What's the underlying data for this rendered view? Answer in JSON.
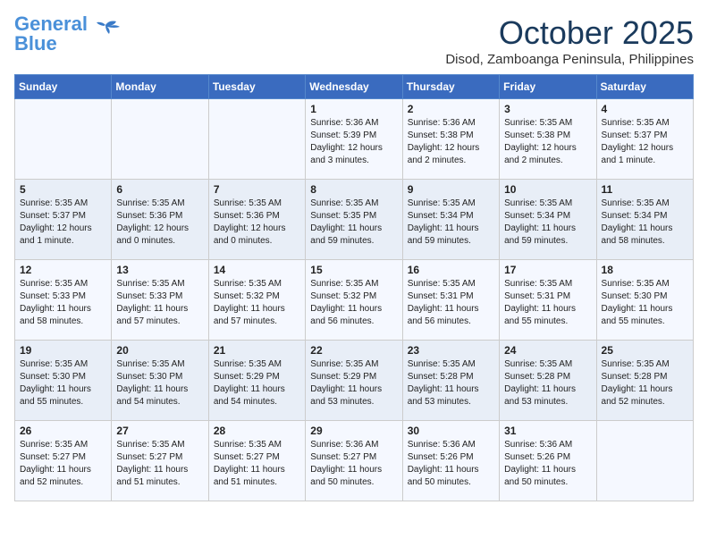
{
  "logo": {
    "line1": "General",
    "line2": "Blue"
  },
  "title": "October 2025",
  "location": "Disod, Zamboanga Peninsula, Philippines",
  "days_header": [
    "Sunday",
    "Monday",
    "Tuesday",
    "Wednesday",
    "Thursday",
    "Friday",
    "Saturday"
  ],
  "weeks": [
    [
      {
        "day": "",
        "info": ""
      },
      {
        "day": "",
        "info": ""
      },
      {
        "day": "",
        "info": ""
      },
      {
        "day": "1",
        "info": "Sunrise: 5:36 AM\nSunset: 5:39 PM\nDaylight: 12 hours and 3 minutes."
      },
      {
        "day": "2",
        "info": "Sunrise: 5:36 AM\nSunset: 5:38 PM\nDaylight: 12 hours and 2 minutes."
      },
      {
        "day": "3",
        "info": "Sunrise: 5:35 AM\nSunset: 5:38 PM\nDaylight: 12 hours and 2 minutes."
      },
      {
        "day": "4",
        "info": "Sunrise: 5:35 AM\nSunset: 5:37 PM\nDaylight: 12 hours and 1 minute."
      }
    ],
    [
      {
        "day": "5",
        "info": "Sunrise: 5:35 AM\nSunset: 5:37 PM\nDaylight: 12 hours and 1 minute."
      },
      {
        "day": "6",
        "info": "Sunrise: 5:35 AM\nSunset: 5:36 PM\nDaylight: 12 hours and 0 minutes."
      },
      {
        "day": "7",
        "info": "Sunrise: 5:35 AM\nSunset: 5:36 PM\nDaylight: 12 hours and 0 minutes."
      },
      {
        "day": "8",
        "info": "Sunrise: 5:35 AM\nSunset: 5:35 PM\nDaylight: 11 hours and 59 minutes."
      },
      {
        "day": "9",
        "info": "Sunrise: 5:35 AM\nSunset: 5:34 PM\nDaylight: 11 hours and 59 minutes."
      },
      {
        "day": "10",
        "info": "Sunrise: 5:35 AM\nSunset: 5:34 PM\nDaylight: 11 hours and 59 minutes."
      },
      {
        "day": "11",
        "info": "Sunrise: 5:35 AM\nSunset: 5:34 PM\nDaylight: 11 hours and 58 minutes."
      }
    ],
    [
      {
        "day": "12",
        "info": "Sunrise: 5:35 AM\nSunset: 5:33 PM\nDaylight: 11 hours and 58 minutes."
      },
      {
        "day": "13",
        "info": "Sunrise: 5:35 AM\nSunset: 5:33 PM\nDaylight: 11 hours and 57 minutes."
      },
      {
        "day": "14",
        "info": "Sunrise: 5:35 AM\nSunset: 5:32 PM\nDaylight: 11 hours and 57 minutes."
      },
      {
        "day": "15",
        "info": "Sunrise: 5:35 AM\nSunset: 5:32 PM\nDaylight: 11 hours and 56 minutes."
      },
      {
        "day": "16",
        "info": "Sunrise: 5:35 AM\nSunset: 5:31 PM\nDaylight: 11 hours and 56 minutes."
      },
      {
        "day": "17",
        "info": "Sunrise: 5:35 AM\nSunset: 5:31 PM\nDaylight: 11 hours and 55 minutes."
      },
      {
        "day": "18",
        "info": "Sunrise: 5:35 AM\nSunset: 5:30 PM\nDaylight: 11 hours and 55 minutes."
      }
    ],
    [
      {
        "day": "19",
        "info": "Sunrise: 5:35 AM\nSunset: 5:30 PM\nDaylight: 11 hours and 55 minutes."
      },
      {
        "day": "20",
        "info": "Sunrise: 5:35 AM\nSunset: 5:30 PM\nDaylight: 11 hours and 54 minutes."
      },
      {
        "day": "21",
        "info": "Sunrise: 5:35 AM\nSunset: 5:29 PM\nDaylight: 11 hours and 54 minutes."
      },
      {
        "day": "22",
        "info": "Sunrise: 5:35 AM\nSunset: 5:29 PM\nDaylight: 11 hours and 53 minutes."
      },
      {
        "day": "23",
        "info": "Sunrise: 5:35 AM\nSunset: 5:28 PM\nDaylight: 11 hours and 53 minutes."
      },
      {
        "day": "24",
        "info": "Sunrise: 5:35 AM\nSunset: 5:28 PM\nDaylight: 11 hours and 53 minutes."
      },
      {
        "day": "25",
        "info": "Sunrise: 5:35 AM\nSunset: 5:28 PM\nDaylight: 11 hours and 52 minutes."
      }
    ],
    [
      {
        "day": "26",
        "info": "Sunrise: 5:35 AM\nSunset: 5:27 PM\nDaylight: 11 hours and 52 minutes."
      },
      {
        "day": "27",
        "info": "Sunrise: 5:35 AM\nSunset: 5:27 PM\nDaylight: 11 hours and 51 minutes."
      },
      {
        "day": "28",
        "info": "Sunrise: 5:35 AM\nSunset: 5:27 PM\nDaylight: 11 hours and 51 minutes."
      },
      {
        "day": "29",
        "info": "Sunrise: 5:36 AM\nSunset: 5:27 PM\nDaylight: 11 hours and 50 minutes."
      },
      {
        "day": "30",
        "info": "Sunrise: 5:36 AM\nSunset: 5:26 PM\nDaylight: 11 hours and 50 minutes."
      },
      {
        "day": "31",
        "info": "Sunrise: 5:36 AM\nSunset: 5:26 PM\nDaylight: 11 hours and 50 minutes."
      },
      {
        "day": "",
        "info": ""
      }
    ]
  ]
}
